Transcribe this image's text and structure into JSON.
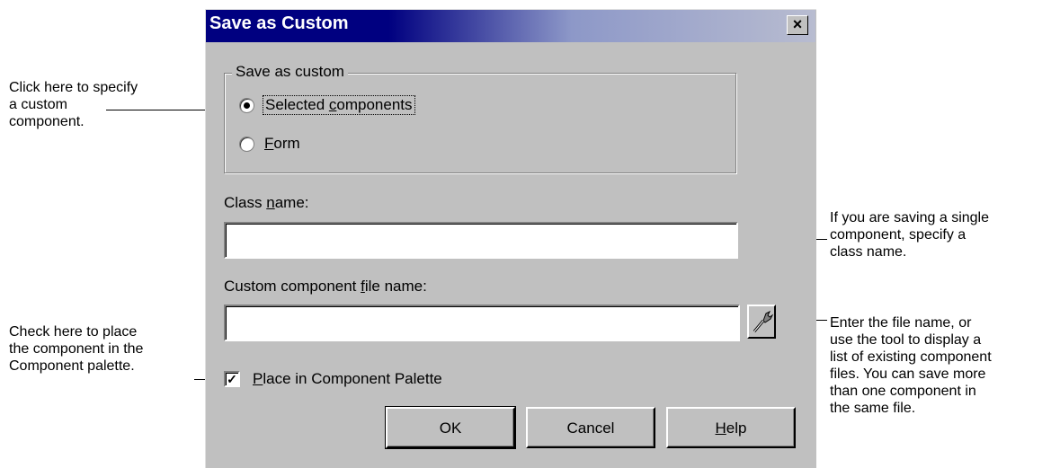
{
  "annotations": {
    "custom_component": "Click here to specify\na custom\ncomponent.",
    "palette": "Check here to place\nthe component in the\nComponent palette.",
    "class_name": "If you are saving a single\ncomponent, specify a\nclass name.",
    "file_name": "Enter the file name, or\nuse the tool to display a\nlist of existing component\nfiles. You can save more\nthan one component in\nthe same file."
  },
  "dialog": {
    "title": "Save as Custom",
    "close_symbol": "×",
    "group_label": "Save as custom",
    "radio_selected": {
      "before": "Selected ",
      "mnemonic": "c",
      "after": "omponents",
      "checked": true
    },
    "radio_form": {
      "before": "",
      "mnemonic": "F",
      "after": "orm",
      "checked": false
    },
    "class_name_label": {
      "before": "Class ",
      "mnemonic": "n",
      "after": "ame:"
    },
    "class_name_value": "",
    "file_name_label": {
      "before": "Custom component ",
      "mnemonic": "f",
      "after": "ile name:"
    },
    "file_name_value": "",
    "browse_icon": "wrench-icon",
    "palette_checkbox": {
      "checked": true,
      "mark": "✓",
      "before": "",
      "mnemonic": "P",
      "after": "lace in Component Palette"
    },
    "buttons": {
      "ok": "OK",
      "cancel": "Cancel",
      "help": {
        "before": "",
        "mnemonic": "H",
        "after": "elp"
      }
    }
  }
}
